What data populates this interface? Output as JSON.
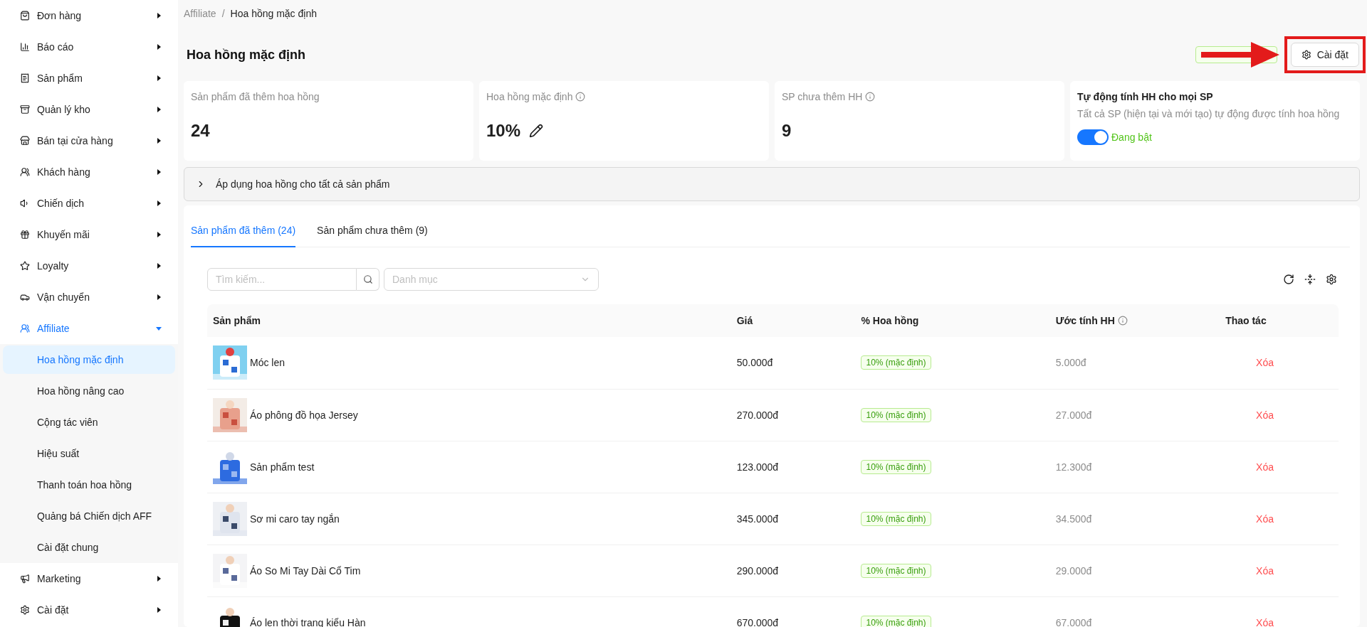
{
  "sidebar": {
    "items": [
      {
        "label": "Đơn hàng",
        "expanded": false
      },
      {
        "label": "Báo cáo",
        "expanded": false
      },
      {
        "label": "Sản phẩm",
        "expanded": false
      },
      {
        "label": "Quản lý kho",
        "expanded": false
      },
      {
        "label": "Bán tại cửa hàng",
        "expanded": false
      },
      {
        "label": "Khách hàng",
        "expanded": false
      },
      {
        "label": "Chiến dịch",
        "expanded": false
      },
      {
        "label": "Khuyến mãi",
        "expanded": false
      },
      {
        "label": "Loyalty",
        "expanded": false
      },
      {
        "label": "Vận chuyển",
        "expanded": false
      },
      {
        "label": "Affiliate",
        "expanded": true,
        "children": [
          {
            "label": "Hoa hồng mặc định",
            "selected": true
          },
          {
            "label": "Hoa hồng nâng cao",
            "selected": false
          },
          {
            "label": "Cộng tác viên",
            "selected": false
          },
          {
            "label": "Hiệu suất",
            "selected": false
          },
          {
            "label": "Thanh toán hoa hồng",
            "selected": false
          },
          {
            "label": "Quảng bá Chiến dịch AFF",
            "selected": false
          },
          {
            "label": "Cài đặt chung",
            "selected": false
          }
        ]
      },
      {
        "label": "Marketing",
        "expanded": false
      },
      {
        "label": "Cài đặt",
        "expanded": false
      }
    ]
  },
  "breadcrumb": [
    "Affiliate",
    "Hoa hồng mặc định"
  ],
  "breadcrumb_separator": "/",
  "page_title": "Hoa hồng mặc định",
  "settings_button": "Cài đặt",
  "stats": [
    {
      "kind": "number",
      "label": "Sản phẩm đã thêm hoa hồng",
      "value": "24",
      "info": false
    },
    {
      "kind": "editable",
      "label": "Hoa hồng mặc định",
      "value": "10%",
      "info": true
    },
    {
      "kind": "number",
      "label": "SP chưa thêm HH",
      "value": "9",
      "info": true
    },
    {
      "kind": "toggle",
      "label": "Tự động tính HH cho mọi SP",
      "description": "Tất cả SP (hiện tại và mới tạo) tự động được tính hoa hồng",
      "on": true,
      "status": "Đang bật"
    }
  ],
  "collapse": {
    "label": "Áp dụng hoa hồng cho tất cả sản phẩm",
    "expanded": false
  },
  "tabs": [
    {
      "label": "Sản phẩm đã thêm (24)",
      "selected": true
    },
    {
      "label": "Sản phẩm chưa thêm (9)",
      "selected": false
    }
  ],
  "search": {
    "placeholder": "Tìm kiếm..."
  },
  "category": {
    "placeholder": "Danh mục"
  },
  "table": {
    "columns": [
      "Sản phẩm",
      "Giá",
      "% Hoa hồng",
      "Ước tính HH",
      "Thao tác"
    ],
    "rows": [
      {
        "name": "Móc len",
        "price": "50.000đ",
        "commission": "10% (mặc định)",
        "estimate": "5.000đ",
        "action": "Xóa"
      },
      {
        "name": "Áo phông đồ họa Jersey",
        "price": "270.000đ",
        "commission": "10% (mặc định)",
        "estimate": "27.000đ",
        "action": "Xóa"
      },
      {
        "name": "Sản phẩm test",
        "price": "123.000đ",
        "commission": "10% (mặc định)",
        "estimate": "12.300đ",
        "action": "Xóa"
      },
      {
        "name": "Sơ mi caro tay ngắn",
        "price": "345.000đ",
        "commission": "10% (mặc định)",
        "estimate": "34.500đ",
        "action": "Xóa"
      },
      {
        "name": "Áo So Mi Tay Dài Cổ Tim",
        "price": "290.000đ",
        "commission": "10% (mặc định)",
        "estimate": "29.000đ",
        "action": "Xóa"
      },
      {
        "name": "Áo len thời trang kiểu Hàn",
        "price": "670.000đ",
        "commission": "10% (mặc định)",
        "estimate": "67.000đ",
        "action": "Xóa"
      }
    ]
  }
}
